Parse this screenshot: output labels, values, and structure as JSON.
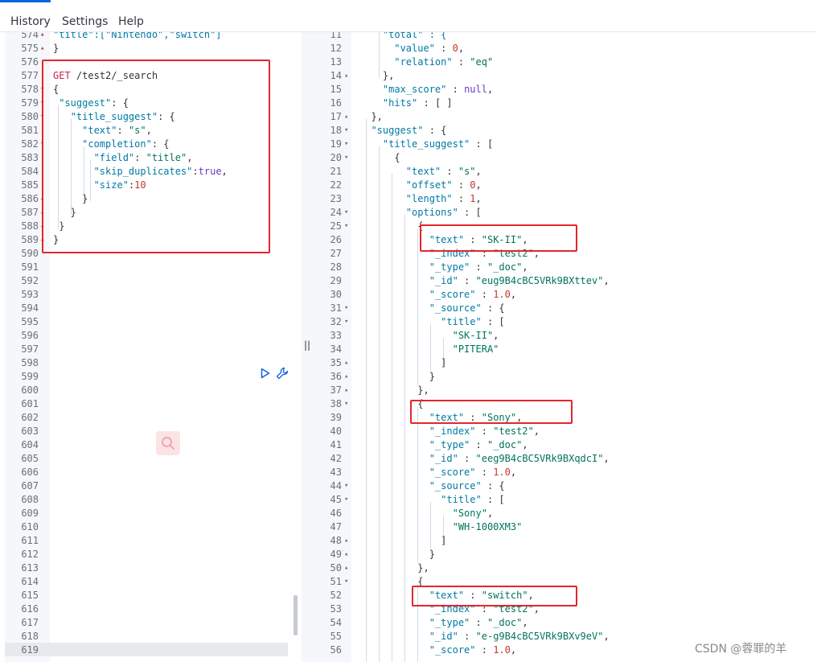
{
  "menu": {
    "history": "History",
    "settings": "Settings",
    "help": "Help"
  },
  "request": {
    "method": "GET",
    "path": "/test2/_search",
    "top_partial": "\"title\":[\"Nintendo\",\"switch\"]"
  },
  "response": {
    "top_partial": "\"total\" : {"
  },
  "splitter_icon": "||",
  "watermark": "CSDN @蓉罪的羊",
  "icons": {
    "run": "play-icon",
    "wrench": "wrench-icon",
    "search": "search-icon"
  },
  "colors": {
    "highlight_box": "#e4262c",
    "method": "#c7254e",
    "key": "#0079a5",
    "string": "#00745b",
    "number": "#c0392b",
    "keyword": "#6b39c4"
  }
}
